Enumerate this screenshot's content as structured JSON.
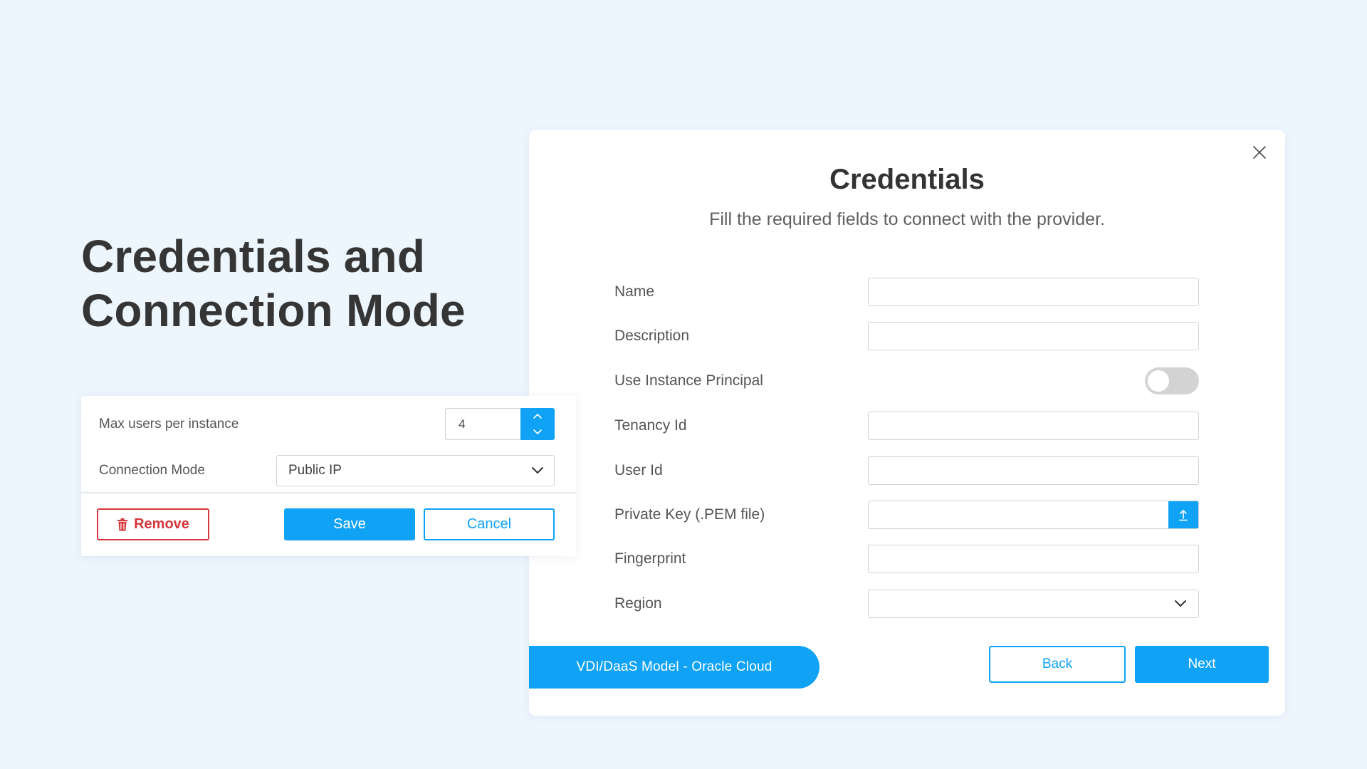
{
  "hero": {
    "line1": "Credentials and",
    "line2": "Connection Mode"
  },
  "modal": {
    "title": "Credentials",
    "subtitle": "Fill the required fields to connect with the provider.",
    "close_icon": "close-icon",
    "fields": {
      "name": {
        "label": "Name",
        "value": "",
        "placeholder": ""
      },
      "description": {
        "label": "Description",
        "value": "",
        "placeholder": ""
      },
      "use_instance_principal": {
        "label": "Use Instance Principal",
        "enabled": false
      },
      "tenancy_id": {
        "label": "Tenancy Id",
        "value": "",
        "placeholder": ""
      },
      "user_id": {
        "label": "User Id",
        "value": "",
        "placeholder": ""
      },
      "private_key": {
        "label": "Private Key (.PEM file)",
        "value": "",
        "icon": "upload-icon"
      },
      "fingerprint": {
        "label": "Fingerprint",
        "value": "",
        "placeholder": ""
      },
      "region": {
        "label": "Region",
        "selected": "",
        "icon": "chevron-down-icon"
      }
    },
    "model_tag": "VDI/DaaS Model - Oracle Cloud",
    "back_label": "Back",
    "next_label": "Next"
  },
  "instance_card": {
    "max_users_label": "Max users per instance",
    "max_users_value": "4",
    "connection_mode_label": "Connection Mode",
    "connection_mode_selected": "Public IP",
    "remove_label": "Remove",
    "save_label": "Save",
    "cancel_label": "Cancel"
  },
  "colors": {
    "accent": "#10a3f5",
    "danger": "#d6363c",
    "background": "#edf5fd"
  }
}
